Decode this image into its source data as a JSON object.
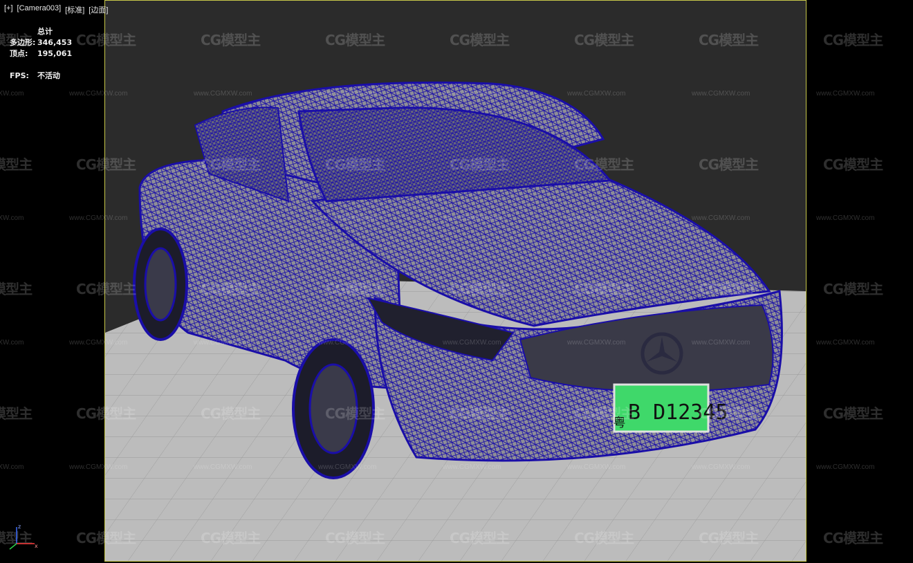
{
  "viewport": {
    "labels": [
      "[+]",
      "[Camera003]",
      "[标准]",
      "[边面]"
    ]
  },
  "stats": {
    "header": "总计",
    "polygons_label": "多边形:",
    "polygons_value": "346,453",
    "vertices_label": "顶点:",
    "vertices_value": "195,061",
    "fps_label": "FPS:",
    "fps_value": "不活动"
  },
  "license_plate": {
    "prefix": "粤",
    "text": "B D12345"
  },
  "watermark": {
    "logo_text": "CG模型主",
    "url": "www.CGMXW.com"
  },
  "gizmo": {
    "z": "z",
    "x": "x",
    "y": "y"
  },
  "colors": {
    "wireframe": "#1a0ea8",
    "viewport_border": "#c8c84a",
    "plate": "#3fd86a",
    "floor": "#bdbdbd",
    "backdrop": "#2a2a2a"
  }
}
